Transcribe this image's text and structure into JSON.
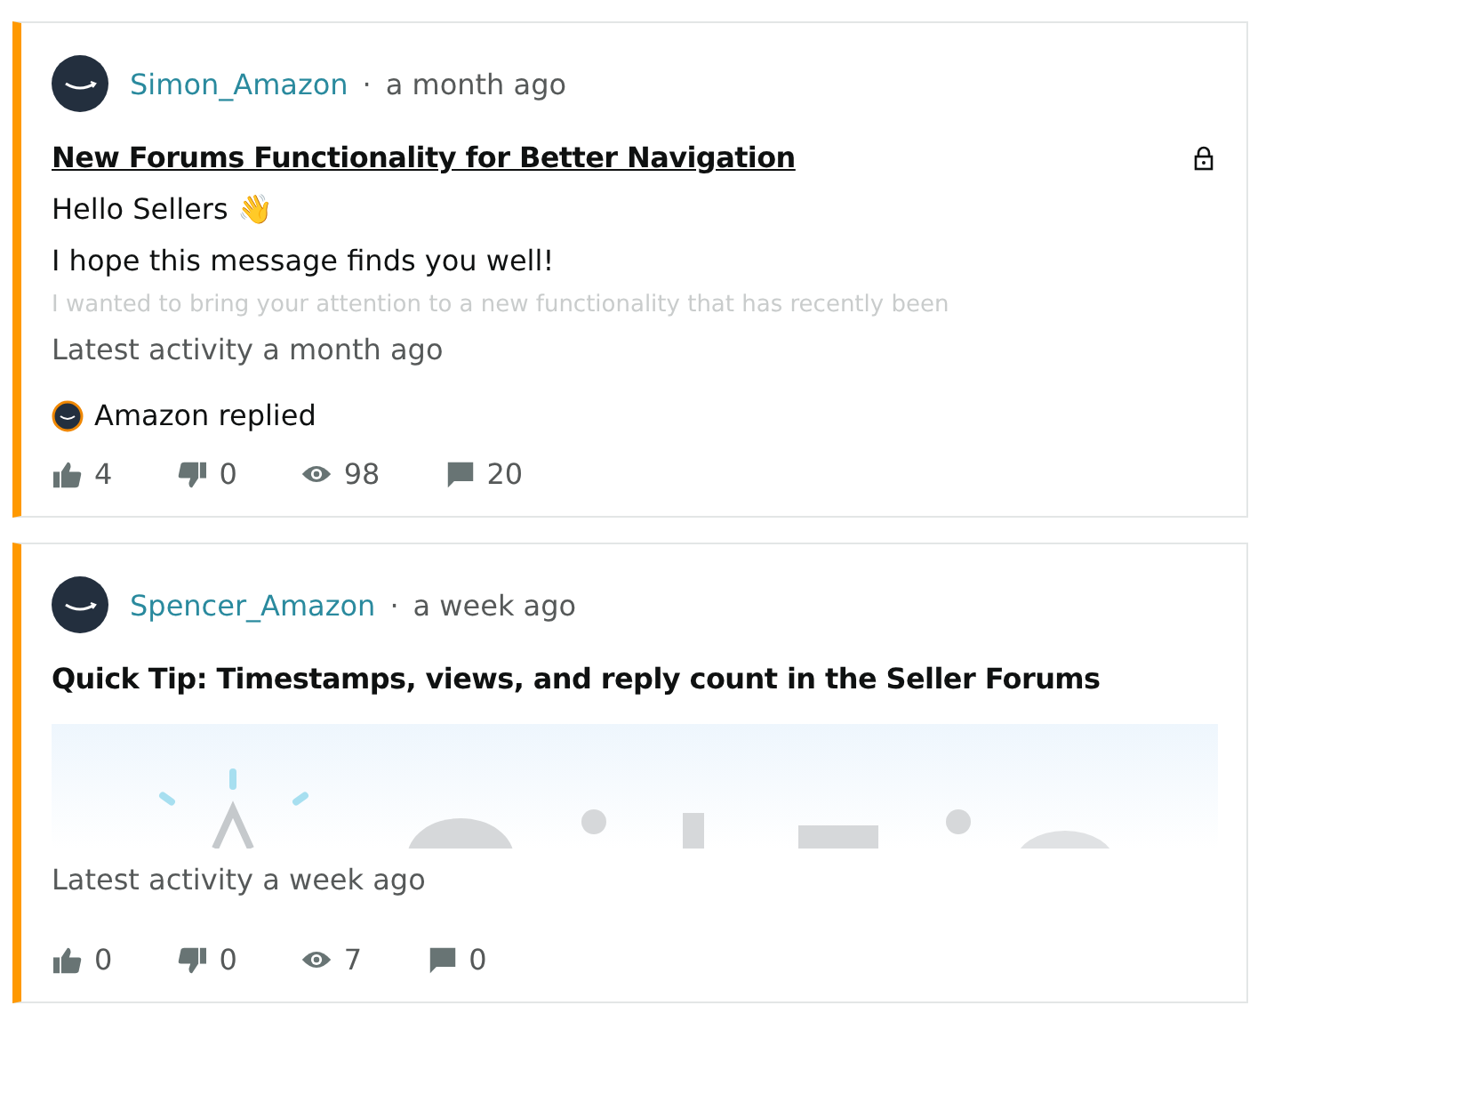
{
  "posts": [
    {
      "author": "Simon_Amazon",
      "separator": "·",
      "time": "a month ago",
      "title": "New Forums Functionality for Better Navigation",
      "title_link": true,
      "locked": true,
      "body": [
        "Hello Sellers 👋",
        "I hope this message finds you well!"
      ],
      "faded_line": "I wanted to bring your attention to a new functionality that has recently been",
      "latest_activity": "Latest activity a month ago",
      "replied_by": "Amazon replied",
      "stats": {
        "likes": "4",
        "dislikes": "0",
        "views": "98",
        "replies": "20"
      }
    },
    {
      "author": "Spencer_Amazon",
      "separator": "·",
      "time": "a week ago",
      "title": "Quick Tip: Timestamps, views, and reply count in the Seller Forums",
      "title_link": false,
      "locked": false,
      "latest_activity": "Latest activity a week ago",
      "stats": {
        "likes": "0",
        "dislikes": "0",
        "views": "7",
        "replies": "0"
      }
    }
  ]
}
